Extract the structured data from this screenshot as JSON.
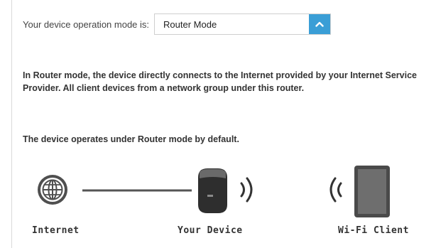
{
  "operation_mode": {
    "label": "Your device operation mode is:",
    "selected": "Router Mode",
    "toggle_icon": "chevron-up-icon",
    "accent_color": "#3a9ed6"
  },
  "description": "In Router mode, the device directly connects to the Internet provided by your Internet Service Provider. All client devices from a network group under this router.",
  "default_note": "The device operates under Router mode by default.",
  "diagram": {
    "internet_label": "Internet",
    "internet_icon": "globe-icon",
    "device_label": "Your Device",
    "device_icon": "router-device-icon",
    "client_label": "Wi-Fi Client",
    "client_icon": "tablet-icon",
    "signal_icon": "wifi-signal-icon"
  }
}
